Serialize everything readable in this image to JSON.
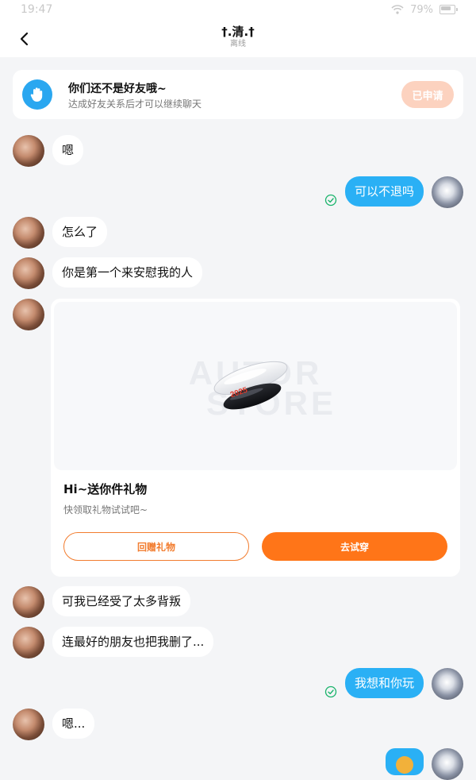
{
  "status_bar": {
    "time": "19:47",
    "battery": "79%"
  },
  "header": {
    "title": "†.清.†",
    "status": "离线"
  },
  "banner": {
    "title": "你们还不是好友哦~",
    "subtitle": "达成好友关系后才可以继续聊天",
    "button": "已申请"
  },
  "messages": {
    "m1": "嗯",
    "m2": "可以不退吗",
    "m3": "怎么了",
    "m4": "你是第一个来安慰我的人",
    "m6": "可我已经受了太多背叛",
    "m7": "连最好的朋友也把我删了...",
    "m8": "我想和你玩",
    "m9": "嗯..."
  },
  "gift": {
    "watermark_line1": "AUTOR",
    "watermark_line2": "STORE",
    "product_text": "2025",
    "title": "Hi~送你件礼物",
    "subtitle": "快领取礼物试试吧~",
    "return_button": "回赠礼物",
    "try_button": "去试穿"
  },
  "colors": {
    "accent_blue": "#2ab0f5",
    "accent_orange": "#ff7518",
    "apply_button_bg": "#fcd2bf",
    "sent_check": "#19b36b"
  },
  "icons": {
    "back": "chevron-left-icon",
    "banner": "hand-wave-icon",
    "sent": "check-circle-icon"
  }
}
